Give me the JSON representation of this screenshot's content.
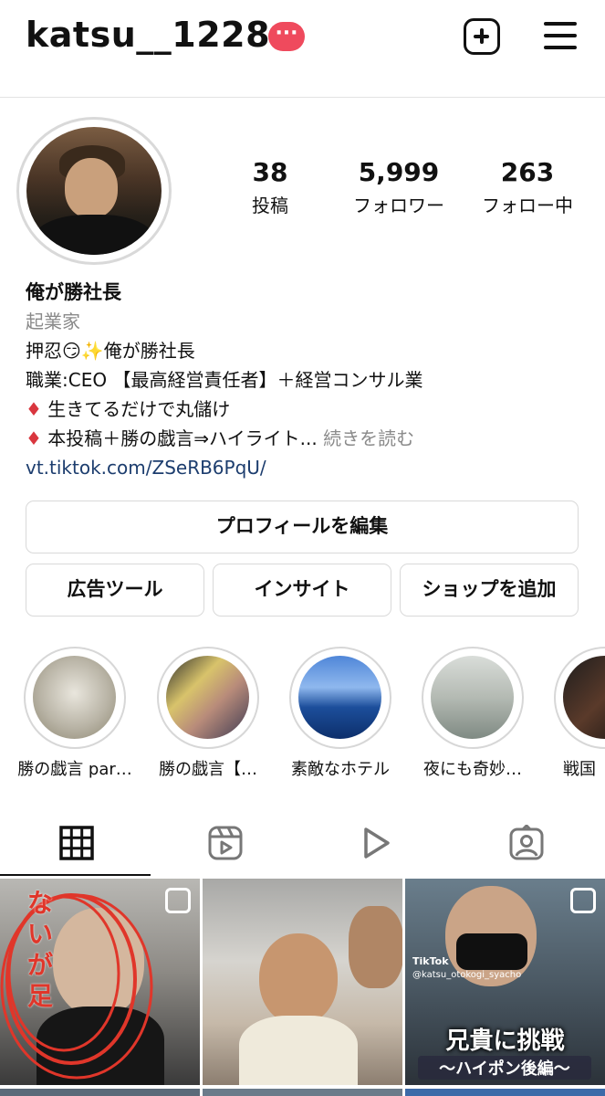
{
  "header": {
    "username": "katsu__1228",
    "badge": "···"
  },
  "profile": {
    "stats": [
      {
        "value": "38",
        "label": "投稿"
      },
      {
        "value": "5,999",
        "label": "フォロワー"
      },
      {
        "value": "263",
        "label": "フォロー中"
      }
    ],
    "name": "俺が勝社長",
    "category": "起業家",
    "bio_lines": [
      "押忍😏✨俺が勝社長",
      "職業:CEO 【最高経営責任者】＋経営コンサル業",
      "生きてるだけで丸儲け",
      "本投稿＋勝の戯言⇒ハイライト..."
    ],
    "bio_diamond": "♦",
    "more_label": "続きを読む",
    "link": "vt.tiktok.com/ZSeRB6PqU/"
  },
  "buttons": {
    "edit_profile": "プロフィールを編集",
    "ad_tools": "広告ツール",
    "insights": "インサイト",
    "add_shop": "ショップを追加"
  },
  "highlights": [
    {
      "label": "勝の戯言 par…"
    },
    {
      "label": "勝の戯言【…"
    },
    {
      "label": "素敵なホテル"
    },
    {
      "label": "夜にも奇妙…"
    },
    {
      "label": "戦国"
    }
  ],
  "tabs": [
    "grid",
    "reels",
    "video",
    "tagged"
  ],
  "posts": [
    {
      "overlay": "ないが足"
    },
    {
      "overlay": ""
    },
    {
      "tag": "TikTok",
      "handle": "@katsu_otokogi_syacho",
      "title": "兄貴に挑戦",
      "subtitle": "〜ハイポン後編〜"
    }
  ]
}
